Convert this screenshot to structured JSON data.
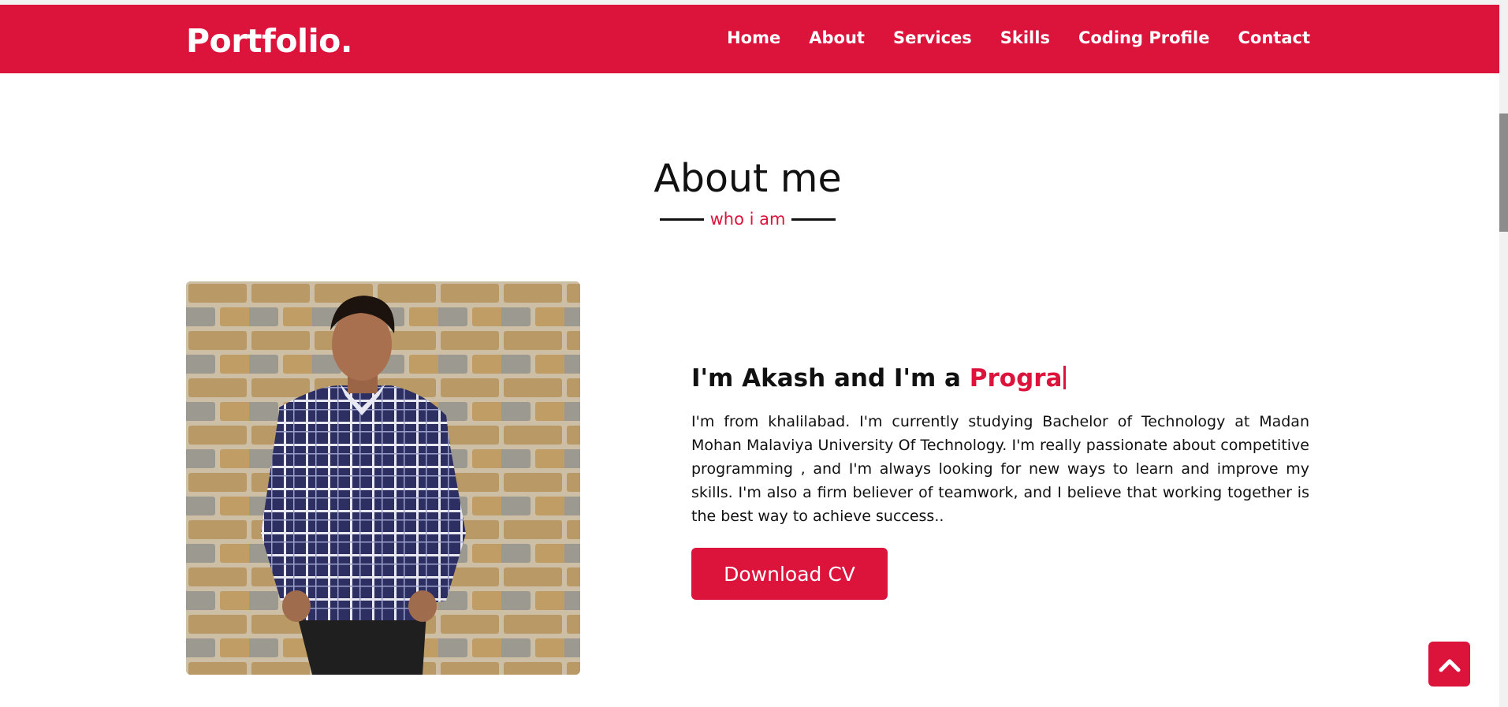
{
  "colors": {
    "accent": "#dc143c",
    "text": "#111111",
    "background": "#ffffff"
  },
  "navbar": {
    "logo": "Portfolio.",
    "items": [
      {
        "label": "Home"
      },
      {
        "label": "About"
      },
      {
        "label": "Services"
      },
      {
        "label": "Skills"
      },
      {
        "label": "Coding Profile"
      },
      {
        "label": "Contact"
      }
    ]
  },
  "about": {
    "title": "About me",
    "subtitle": "who i am",
    "heading_prefix": "I'm Akash and I'm a ",
    "heading_typed": "Progra",
    "paragraph": "I'm from khalilabad. I'm currently studying Bachelor of Technology at Madan Mohan Malaviya University Of Technology. I'm really passionate about competitive programming , and I'm always looking for new ways to learn and improve my skills. I'm also a firm believer of teamwork, and I believe that working together is the best way to achieve success..",
    "cta_label": "Download CV"
  },
  "icons": {
    "back_to_top": "chevron-up-icon"
  }
}
